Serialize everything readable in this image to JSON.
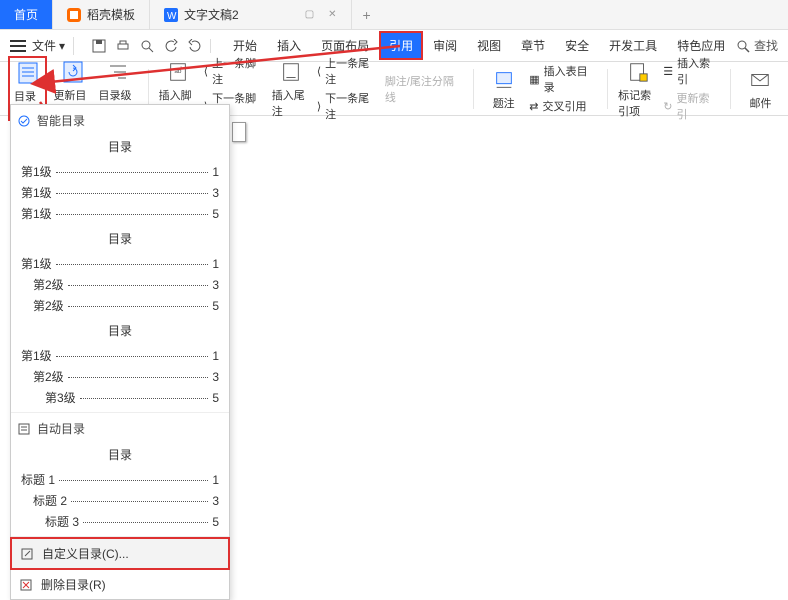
{
  "tabs": {
    "home": "首页",
    "template": "稻壳模板",
    "doc": "文字文稿2",
    "add": "+"
  },
  "menu": {
    "file": "文件",
    "dropdown_glyph": "▾",
    "items": [
      "开始",
      "插入",
      "页面布局",
      "引用",
      "审阅",
      "视图",
      "章节",
      "安全",
      "开发工具",
      "特色应用"
    ],
    "active_index": 3,
    "search": "查找"
  },
  "ribbon": {
    "toc": "目录",
    "update_toc": "更新目录",
    "toc_level": "目录级别",
    "insert_footnote": "插入脚注",
    "prev_footnote": "上一条脚注",
    "next_footnote": "下一条脚注",
    "insert_endnote": "插入尾注",
    "prev_endnote": "上一条尾注",
    "next_endnote": "下一条尾注",
    "fn_divider": "脚注/尾注分隔线",
    "caption": "题注",
    "insert_tbl_toc": "插入表目录",
    "crossref": "交叉引用",
    "mark_index": "标记索引项",
    "insert_index": "插入索引",
    "update_index": "更新索引",
    "mail": "邮件"
  },
  "dropdown": {
    "smart": "智能目录",
    "title": "目录",
    "s1": {
      "r1l": "第1级",
      "r1p": "1",
      "r2l": "第1级",
      "r2p": "3",
      "r3l": "第1级",
      "r3p": "5"
    },
    "s2": {
      "r1l": "第1级",
      "r1p": "1",
      "r2l": "第2级",
      "r2p": "3",
      "r3l": "第2级",
      "r3p": "5"
    },
    "s3": {
      "r1l": "第1级",
      "r1p": "1",
      "r2l": "第2级",
      "r2p": "3",
      "r3l": "第3级",
      "r3p": "5"
    },
    "auto": "自动目录",
    "s4": {
      "r1l": "标题 1",
      "r1p": "1",
      "r2l": "标题 2",
      "r2p": "3",
      "r3l": "标题 3",
      "r3p": "5"
    },
    "custom": "自定义目录(C)...",
    "delete": "删除目录(R)"
  }
}
